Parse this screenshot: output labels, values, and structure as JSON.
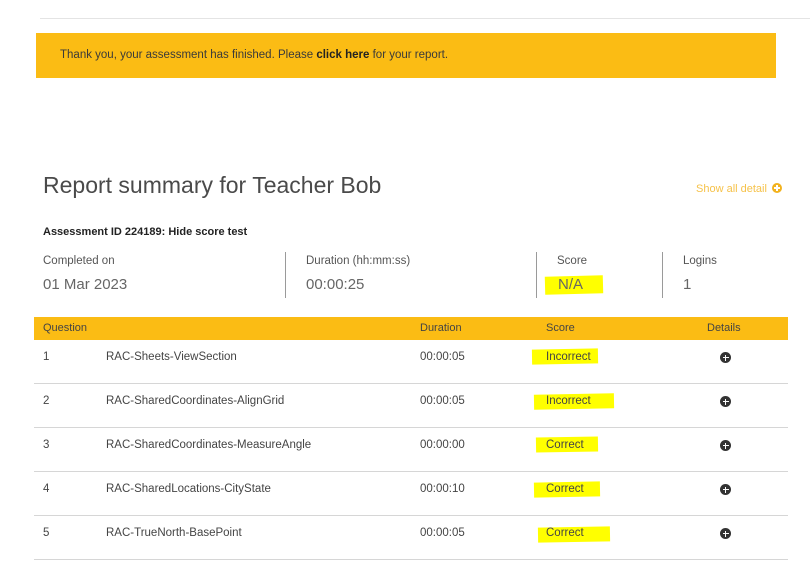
{
  "banner": {
    "text_before": "Thank you, your assessment has finished. Please ",
    "link": "click here",
    "text_after": " for your report."
  },
  "report": {
    "title": "Report summary for Teacher Bob",
    "show_all": "Show all detail",
    "assessment": "Assessment ID 224189: Hide score test"
  },
  "stats": {
    "completed_label": "Completed on",
    "completed_value": "01 Mar 2023",
    "duration_label": "Duration (hh:mm:ss)",
    "duration_value": "00:00:25",
    "score_label": "Score",
    "score_value": "N/A",
    "logins_label": "Logins",
    "logins_value": "1"
  },
  "table": {
    "headers": {
      "question": "Question",
      "duration": "Duration",
      "score": "Score",
      "details": "Details"
    },
    "rows": [
      {
        "num": "1",
        "name": "RAC-Sheets-ViewSection",
        "duration": "00:00:05",
        "score": "Incorrect"
      },
      {
        "num": "2",
        "name": "RAC-SharedCoordinates-AlignGrid",
        "duration": "00:00:05",
        "score": "Incorrect"
      },
      {
        "num": "3",
        "name": "RAC-SharedCoordinates-MeasureAngle",
        "duration": "00:00:00",
        "score": "Correct"
      },
      {
        "num": "4",
        "name": "RAC-SharedLocations-CityState",
        "duration": "00:00:10",
        "score": "Correct"
      },
      {
        "num": "5",
        "name": "RAC-TrueNorth-BasePoint",
        "duration": "00:00:05",
        "score": "Correct"
      }
    ]
  },
  "colors": {
    "accent": "#fbbc14",
    "highlight": "#ffff00"
  }
}
